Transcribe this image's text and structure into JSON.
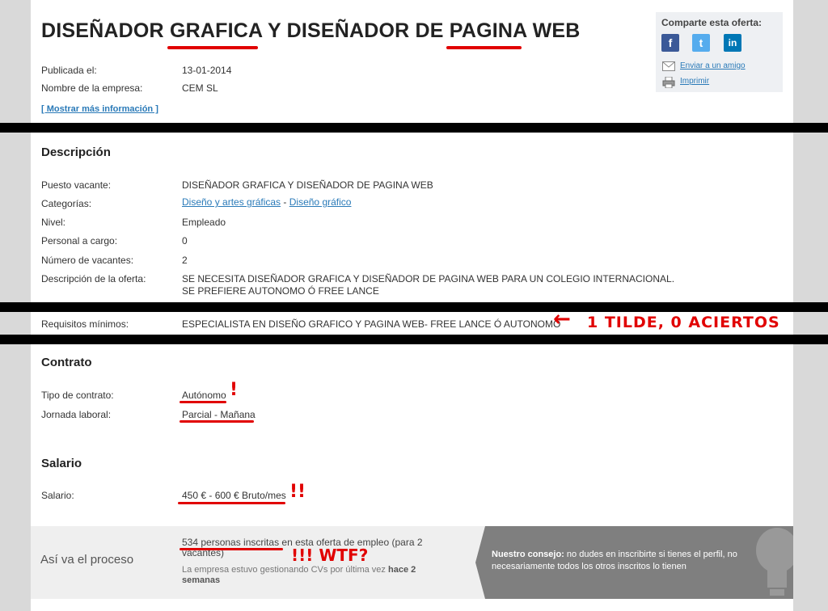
{
  "job": {
    "title": "DISEÑADOR GRAFICA Y DISEÑADOR DE PAGINA WEB",
    "published_label": "Publicada el:",
    "published_value": "13-01-2014",
    "company_label": "Nombre de la empresa:",
    "company_value": "CEM SL",
    "more_info_link": "[ Mostrar más información ]"
  },
  "share": {
    "title": "Comparte esta oferta:",
    "facebook": "f",
    "twitter": "t",
    "linkedin": "in",
    "email_link": "Enviar a un amigo",
    "print_link": "Imprimir"
  },
  "description": {
    "heading": "Descripción",
    "fields": [
      {
        "label": "Puesto vacante:",
        "value": "DISEÑADOR GRAFICA Y DISEÑADOR DE PAGINA WEB"
      },
      {
        "label": "Categorías:",
        "value": ""
      },
      {
        "label": "Nivel:",
        "value": "Empleado"
      },
      {
        "label": "Personal a cargo:",
        "value": "0"
      },
      {
        "label": "Número de vacantes:",
        "value": "2"
      },
      {
        "label": "Descripción de la oferta:",
        "value": "SE NECESITA DISEÑADOR GRAFICA Y DISEÑADOR DE PAGINA WEB PARA UN COLEGIO INTERNACIONAL."
      },
      {
        "label": "Requisitos mínimos:",
        "value": "ESPECIALISTA EN DISEÑO GRAFICO Y PAGINA WEB- FREE LANCE Ó AUTONOMO"
      }
    ],
    "description_line2": "SE PREFIERE AUTONOMO Ó FREE LANCE",
    "category_1": "Diseño y artes gráficas",
    "category_sep": "-",
    "category_2": "Diseño gráfico"
  },
  "contract": {
    "heading": "Contrato",
    "type_label": "Tipo de contrato:",
    "type_value": "Autónomo",
    "schedule_label": "Jornada laboral:",
    "schedule_value": "Parcial - Mañana"
  },
  "salary": {
    "heading": "Salario",
    "label": "Salario:",
    "value": "450 € - 600 € Bruto/mes"
  },
  "process": {
    "heading": "Así va el proceso",
    "inscribed": "534 personas inscritas en esta oferta de empleo (para 2 vacantes)",
    "managed_prefix": "La empresa estuvo gestionando CVs por última vez ",
    "managed_time": "hace 2 semanas",
    "advice_title": "Nuestro consejo:",
    "advice_text": " no dudes en inscribirte si tienes el perfil, no necesariamente todos los otros inscritos lo tienen"
  },
  "annotations": {
    "tilde": "1 TILDE, 0 ACIERTOS",
    "arrow": "←",
    "exclaim_1": "!",
    "exclaim_2": "!!",
    "wtf": "!!! WTF?"
  },
  "colors": {
    "annotation_red": "#e10000",
    "link_blue": "#2a7ab8",
    "facebook": "#3b5998",
    "twitter": "#55acee",
    "linkedin": "#0077b5"
  }
}
